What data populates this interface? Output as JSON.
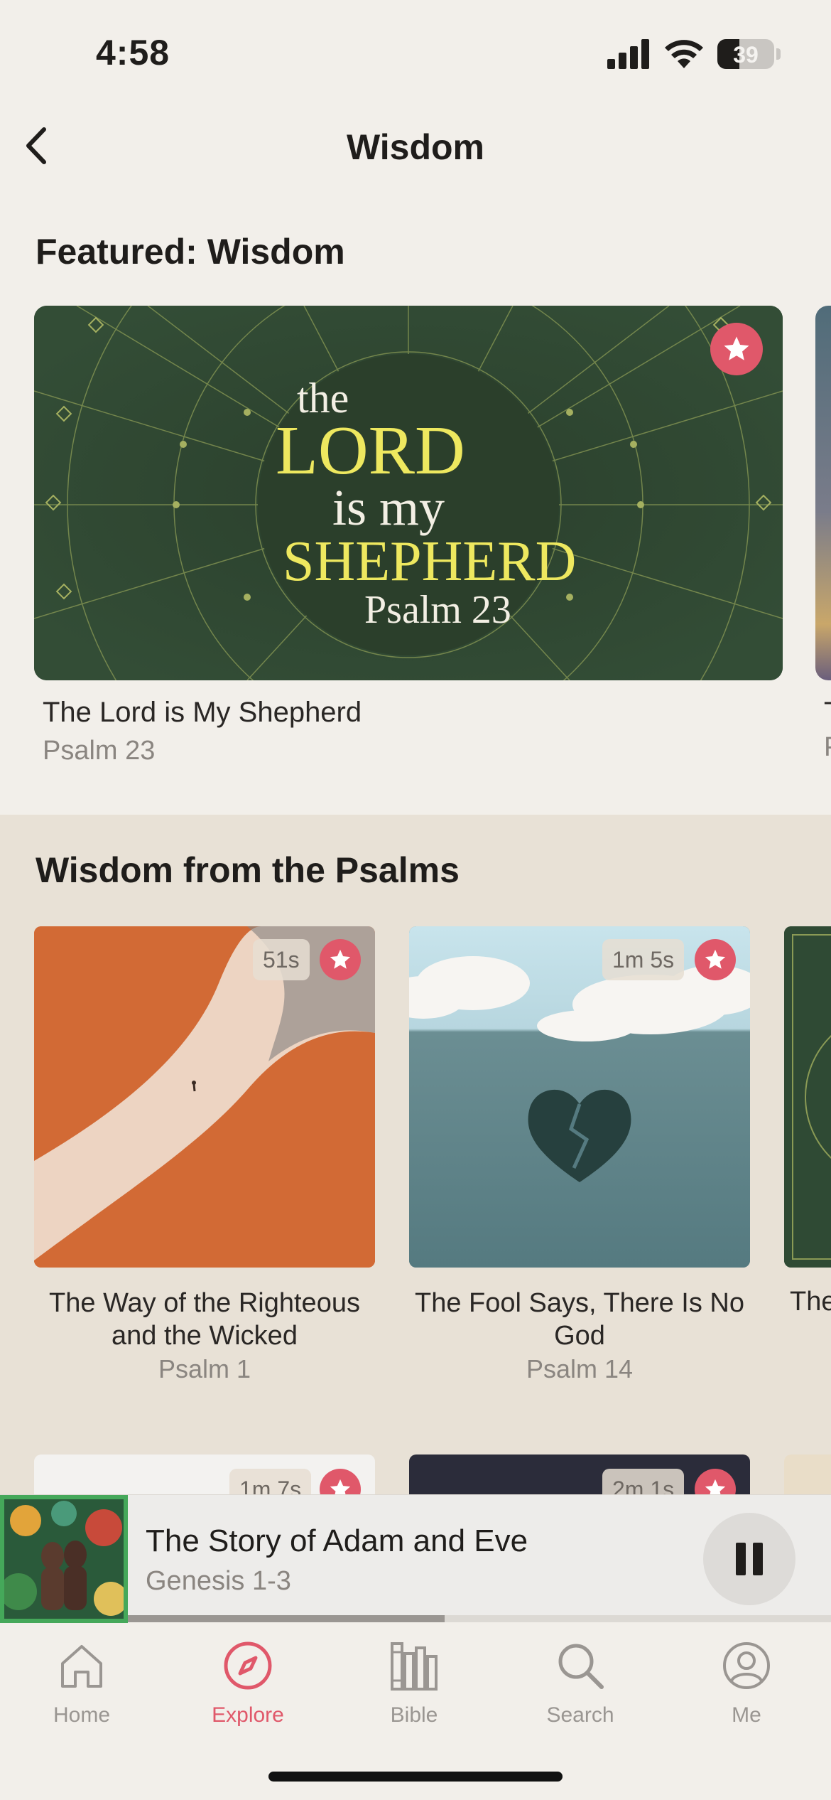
{
  "status": {
    "time": "4:58",
    "battery": "39",
    "battery_level": 0.39
  },
  "nav": {
    "title": "Wisdom"
  },
  "featured": {
    "section_title": "Featured: Wisdom",
    "card": {
      "art_line1": "the",
      "art_line2": "LORD",
      "art_line3": "is my",
      "art_line4": "SHEPHERD",
      "art_line5": "Psalm 23",
      "title": "The Lord is My Shepherd",
      "subtitle": "Psalm 23"
    },
    "peek_title": "T",
    "peek_subtitle": "P"
  },
  "psalms": {
    "section_title": "Wisdom from the Psalms",
    "cards": [
      {
        "duration": "51s",
        "title": "The Way of the Righteous and the Wicked",
        "subtitle": "Psalm 1"
      },
      {
        "duration": "1m 5s",
        "title": "The Fool Says, There Is No God",
        "subtitle": "Psalm 14"
      },
      {
        "title": "The"
      }
    ],
    "row2": [
      {
        "duration": "1m 7s"
      },
      {
        "duration": "2m 1s"
      }
    ]
  },
  "player": {
    "title": "The Story of Adam and Eve",
    "subtitle": "Genesis 1-3",
    "progress": 0.45
  },
  "tabs": [
    {
      "label": "Home",
      "icon": "home-icon"
    },
    {
      "label": "Explore",
      "icon": "compass-icon",
      "active": true
    },
    {
      "label": "Bible",
      "icon": "books-icon"
    },
    {
      "label": "Search",
      "icon": "search-icon"
    },
    {
      "label": "Me",
      "icon": "profile-icon"
    }
  ],
  "colors": {
    "accent": "#e0586a",
    "background": "#f2efea",
    "section_bg": "#e8e1d6",
    "player_border": "#45a85a"
  }
}
